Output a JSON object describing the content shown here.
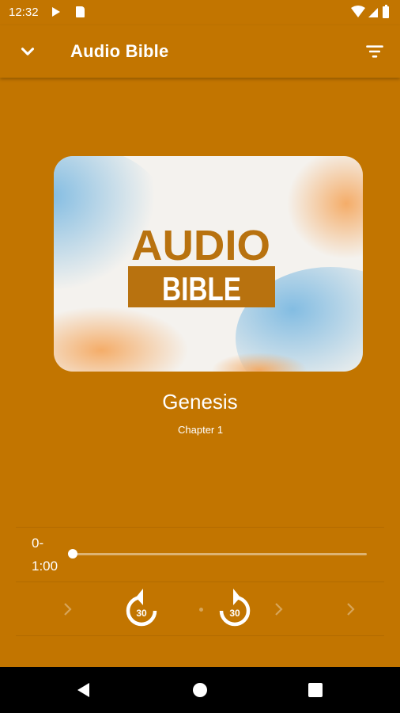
{
  "status_bar": {
    "time": "12:32"
  },
  "app_bar": {
    "title": "Audio Bible"
  },
  "cover": {
    "line1": "AUDIO",
    "line2": "BIBLE"
  },
  "track": {
    "title": "Genesis",
    "subtitle": "Chapter 1"
  },
  "player": {
    "position": "0-",
    "duration": "1:00",
    "progress": 0,
    "rewind_seconds": "30",
    "forward_seconds": "30"
  },
  "colors": {
    "background": "#C27500",
    "accent": "#B8720F",
    "foreground": "#FFFFFF"
  }
}
